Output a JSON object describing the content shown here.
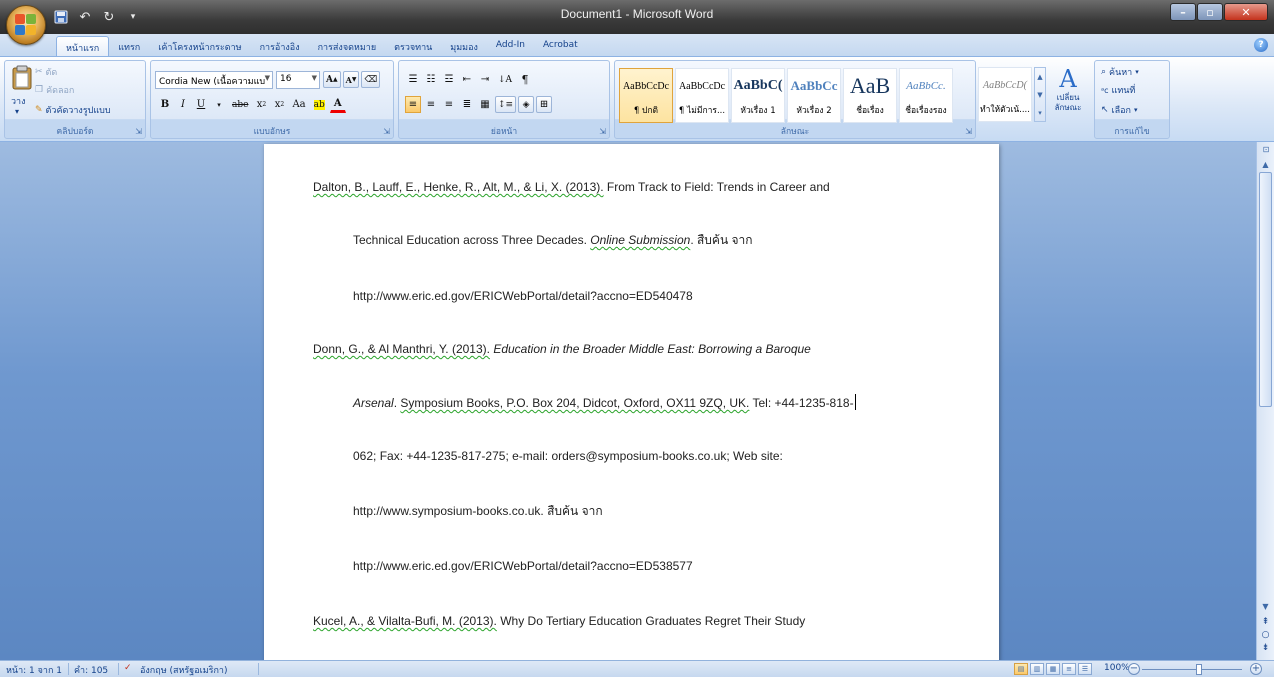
{
  "window": {
    "title": "Document1 - Microsoft Word"
  },
  "tabs": [
    "หน้าแรก",
    "แทรก",
    "เค้าโครงหน้ากระดาษ",
    "การอ้างอิง",
    "การส่งจดหมาย",
    "ตรวจทาน",
    "มุมมอง",
    "Add-In",
    "Acrobat"
  ],
  "ribbon": {
    "clipboard": {
      "label": "คลิปบอร์ด",
      "paste": "วาง",
      "cut": "ตัด",
      "copy": "คัดลอก",
      "format_painter": "ตัวคัดวางรูปแบบ"
    },
    "font": {
      "label": "แบบอักษร",
      "font_name": "Cordia New (เนื้อความแบ",
      "font_size": "16"
    },
    "paragraph": {
      "label": "ย่อหน้า"
    },
    "styles": {
      "label": "ลักษณะ",
      "change_styles": "เปลี่ยน ลักษณะ",
      "tiles": [
        {
          "sample": "AaBbCcDc",
          "name": "¶ ปกติ"
        },
        {
          "sample": "AaBbCcDc",
          "name": "¶ ไม่มีการ..."
        },
        {
          "sample": "AaBbC(",
          "name": "หัวเรื่อง 1"
        },
        {
          "sample": "AaBbCc",
          "name": "หัวเรื่อง 2"
        },
        {
          "sample": "AaB",
          "name": "ชื่อเรื่อง"
        },
        {
          "sample": "AaBbCc.",
          "name": "ชื่อเรื่องรอง"
        },
        {
          "sample": "AaBbCcD(",
          "name": "ทำให้ตัวเน้...."
        }
      ]
    },
    "editing": {
      "label": "การแก้ไข",
      "find": "ค้นหา",
      "replace": "แทนที่",
      "select": "เลือก"
    }
  },
  "document": {
    "lines": [
      {
        "a": "Dalton, B., Lauff, E., Henke, R., Alt, M., & Li, X. (2013).",
        "b": " From Track to Field: Trends in Career and"
      },
      {
        "a": "Technical Education across Three Decades. ",
        "b": "Online Submission",
        "c": ". สืบค้น จาก"
      },
      {
        "a": "http://www.eric.ed.gov/ERICWebPortal/detail?accno=ED540478"
      },
      {
        "a": "Donn, G., & Al Manthri, Y. (2013).",
        "b": " Education in the Broader Middle East: Borrowing a Baroque"
      },
      {
        "a": "Arsenal",
        "b": ". ",
        "c": "Symposium Books, P.O. Box 204, Didcot, Oxford, OX11 9ZQ, UK.",
        "d": " Tel: +44-1235-818-"
      },
      {
        "a": "062; Fax: +44-1235-817-275; e-mail: orders@symposium-books.co.uk; Web site:"
      },
      {
        "a": "http://www.symposium-books.co.uk. สืบค้น จาก"
      },
      {
        "a": "http://www.eric.ed.gov/ERICWebPortal/detail?accno=ED538577"
      },
      {
        "a": "Kucel, A., & Vilalta-Bufi, M. (2013).",
        "b": " Why Do Tertiary Education Graduates Regret Their Study"
      }
    ]
  },
  "status": {
    "page": "หน้า: 1 จาก 1",
    "words": "คำ: 105",
    "language": "อังกฤษ (สหรัฐอเมริกา)",
    "zoom": "100%"
  }
}
